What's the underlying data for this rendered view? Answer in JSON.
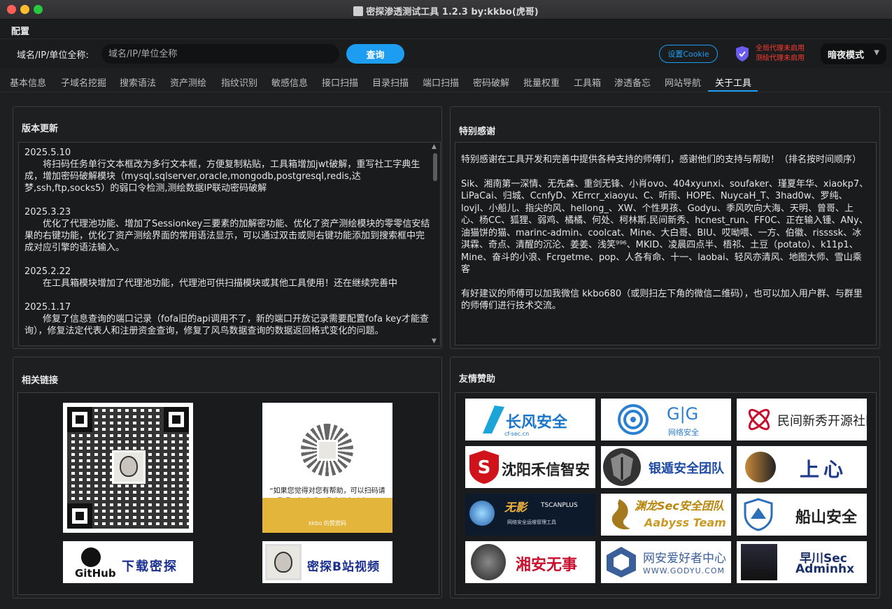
{
  "window": {
    "title": "密探渗透测试工具 1.2.3 by:kkbo(虎哥)"
  },
  "menu": {
    "config": "配置"
  },
  "search": {
    "label": "域名/IP/单位全称:",
    "placeholder": "域名/IP/单位全称",
    "query_button": "查询",
    "cookie_button": "设置Cookie",
    "proxy_global": "全局代理未启用",
    "proxy_test": "测绘代理未启用",
    "mode": "暗夜模式"
  },
  "tabs": [
    "基本信息",
    "子域名挖掘",
    "搜索语法",
    "资产测绘",
    "指纹识别",
    "敏感信息",
    "接口扫描",
    "目录扫描",
    "端口扫描",
    "密码破解",
    "批量权重",
    "工具箱",
    "渗透备忘",
    "网站导航",
    "关于工具"
  ],
  "active_tab": "关于工具",
  "updates_panel": {
    "title": "版本更新",
    "entries": [
      {
        "date": "2025.5.10",
        "text": "将扫码任务单行文本框改为多行文本框，方便复制粘贴，工具箱增加jwt破解，重写社工字典生成，增加密码破解模块（mysql,sqlserver,oracle,mongodb,postgresql,redis,达梦,ssh,ftp,socks5）的弱口令检测,测绘数据IP联动密码破解"
      },
      {
        "date": "2025.3.23",
        "text": "优化了代理池功能、增加了Sessionkey三要素的加解密功能、优化了资产测绘模块的零零信安结果的右键功能，优化了资产测绘界面的常用语法显示，可以通过双击或则右键功能添加到搜索框中完成对应引擎的语法输入。"
      },
      {
        "date": "2025.2.22",
        "text": "在工具箱模块增加了代理池功能，代理池可供扫描模块或其他工具使用！还在继续完善中"
      },
      {
        "date": "2025.1.17",
        "text": "修复了信息查询的端口记录（fofa旧的api调用不了，新的端口开放记录需要配置fofa key才能查询），修复法定代表人和注册资金查询，修复了风鸟数据查询的数据返回格式变化的问题。"
      }
    ]
  },
  "thanks_panel": {
    "title": "特别感谢",
    "intro": "特别感谢在工具开发和完善中提供各种支持的师傅们，感谢他们的支持与帮助！（排名按时间顺序）",
    "names": "Sik、湘南第一深情、无先森、重剑无锋、小肖ovo、404xyunxi、soufaker、瑾夏年华、xiaokp7、LiPaCai、归城、CcnfyD、XErrcr_xiaoyu、C、听雨、HOPE、NuycaH_T、3had0w、罗纯、lovjl、小船儿、指尖的风、hellong_、XW、个性男孩、Godyu、季风吹向大海、天明、曾哥、上心、杨CC、狐狸、弱鸡、橘橘、何处、柯林斯.民间新秀、hcnest_run、FF0C、正在输入锺、ANy、油猫饼的猫、marinc-admin、coolcat、Mine、大白哥、BIU、哎呦喂、一方、伯徽、rissssk、冰淇霖、奇点、清醒的沉沦、姜姜、浅笑⁹⁹⁶、MKID、凌晨四点半、梧祁、土豆（potato）、k11p1、Mine、奋斗的小浪、Fcrgetme、pop、人各有命、十一、laobai、轻风亦清风、地图大师、雪山乘客",
    "contact": "有好建议的师傅可以加我微信 kkbo680（或则扫左下角的微信二维码），也可以加入用户群、与群里的师傅们进行技术交流。"
  },
  "links_panel": {
    "title": "相关链接",
    "reward_caption": "“如果您觉得对您有帮助，可以扫码请我喝一杯咖啡，我会更有动力！”",
    "reward_sign": "kkbo 的赞赏码",
    "github_label": "GitHub",
    "download_label": "下载密探",
    "bilibili_label": "密探B站视频"
  },
  "sponsors_panel": {
    "title": "友情赞助",
    "sponsors": [
      {
        "name": "长风安全",
        "sub": "cf-sec.cn"
      },
      {
        "name": "G|G",
        "sub": "网络安全"
      },
      {
        "name": "民间新秀开源社区",
        "sub": ""
      },
      {
        "name": "沈阳禾信智安",
        "sub": ""
      },
      {
        "name": "银遁安全团队",
        "sub": ""
      },
      {
        "name": "上心",
        "sub": ""
      },
      {
        "name": "无影",
        "sub": "TSCANPLUS",
        "sub2": "网络安全运维管理工具"
      },
      {
        "name": "渊龙Sec安全团队",
        "sub": "Aabyss Team"
      },
      {
        "name": "船山安全",
        "sub": ""
      },
      {
        "name": "湘安无事",
        "sub": ""
      },
      {
        "name": "网安爱好者中心",
        "sub": "WWW.GODYU.COM"
      },
      {
        "name": "早川Sec",
        "sub": "Adminhx"
      }
    ]
  },
  "colors": {
    "accent": "#1c9df2",
    "warning": "#ff3b30",
    "background": "#1e1f21"
  }
}
